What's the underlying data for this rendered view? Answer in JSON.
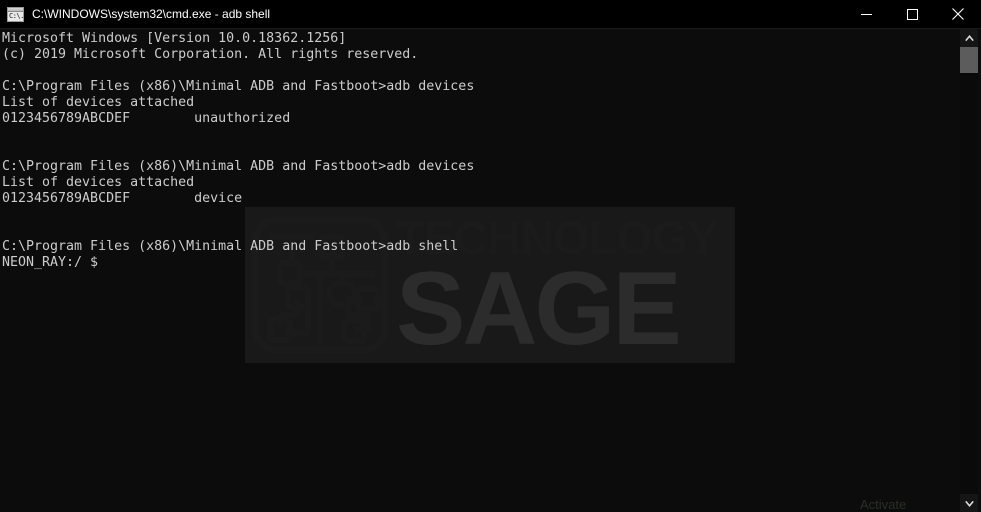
{
  "window": {
    "title": "C:\\WINDOWS\\system32\\cmd.exe - adb shell",
    "icon": "cmd-console-icon",
    "icon_glyph": "C:\\.",
    "background_color": "#0c0c0c",
    "titlebar_color": "#000000",
    "text_color": "#cccccc"
  },
  "titlebar_buttons": {
    "minimize_label": "Minimize",
    "maximize_label": "Maximize",
    "close_label": "Close"
  },
  "terminal": {
    "prompt_path": "C:\\Program Files (x86)\\Minimal ADB and Fastboot>",
    "device_serial": "0123456789ABCDEF",
    "lines": [
      "Microsoft Windows [Version 10.0.18362.1256]",
      "(c) 2019 Microsoft Corporation. All rights reserved.",
      "",
      "C:\\Program Files (x86)\\Minimal ADB and Fastboot>adb devices",
      "List of devices attached",
      "0123456789ABCDEF        unauthorized",
      "",
      "",
      "C:\\Program Files (x86)\\Minimal ADB and Fastboot>adb devices",
      "List of devices attached",
      "0123456789ABCDEF        device",
      "",
      "",
      "C:\\Program Files (x86)\\Minimal ADB and Fastboot>adb shell",
      "NEON_RAY:/ $"
    ],
    "commands": [
      "adb devices",
      "adb devices",
      "adb shell"
    ],
    "device_states": [
      "unauthorized",
      "device"
    ],
    "shell_prompt": "NEON_RAY:/ $"
  },
  "watermark": {
    "line1": "TECHNOLOGY",
    "line2": "SAGE",
    "logo_name": "circuit-board-logo"
  },
  "scrollbar": {
    "up_arrow": "scroll-up-arrow",
    "down_arrow": "scroll-down-arrow",
    "thumb": "scroll-thumb"
  },
  "bottom_overlay": {
    "text": "Activate"
  }
}
